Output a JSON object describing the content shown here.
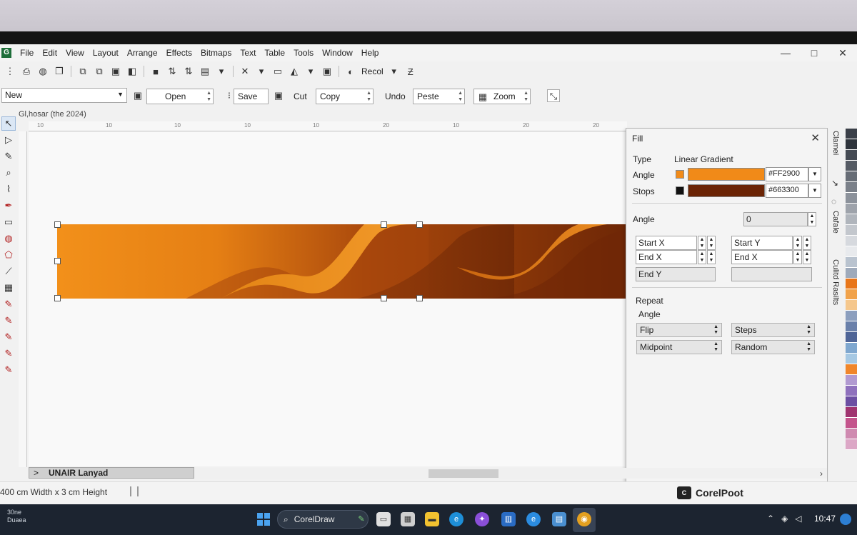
{
  "menu": [
    "File",
    "Edit",
    "View",
    "Layout",
    "Arrange",
    "Effects",
    "Bitmaps",
    "Text",
    "Table",
    "Tools",
    "Window",
    "Help"
  ],
  "window_controls": {
    "minimize": "—",
    "maximize": "□",
    "close": "✕"
  },
  "toolbar1": {
    "recol_label": "Recol"
  },
  "propbar": {
    "preset_value": "New",
    "open_label": "Open",
    "save_label": "Save",
    "cut_label": "Cut",
    "copy_label": "Copy",
    "undo_label": "Undo",
    "paste_label": "Peste",
    "zoom_label": "Zoom"
  },
  "document": {
    "title": "Gl,hosar (the 2024)"
  },
  "ruler_ticks": [
    "10",
    "10",
    "10",
    "10",
    "10",
    "20",
    "10",
    "20",
    "20",
    "20"
  ],
  "fill_panel": {
    "title": "Fill",
    "type_label": "Type",
    "type_value": "Linear Gradient",
    "angle_label": "Angle",
    "stops_label": "Stops",
    "color1_hex": "#FF2900",
    "color1_display": "#f18a18",
    "color2_hex": "#663300",
    "color2_display": "#6b2405",
    "angle2_label": "Angle",
    "angle_value": "0",
    "start_x": "Start X",
    "end_x": "End X",
    "start_y": "Start Y",
    "end_x_right": "End X",
    "end_y": "End Y",
    "repeat_label": "Repeat",
    "repeat_angle_label": "Angle",
    "flip_option": "Flip",
    "steps_option": "Steps",
    "midpoint_option": "Midpoint",
    "random_option": "Random"
  },
  "docker_tabs": [
    "Clamei",
    "Cafale",
    "Culitd Rasilts"
  ],
  "palette_colors": [
    "#3a3f48",
    "#2d333b",
    "#444a53",
    "#555b64",
    "#676d76",
    "#7a8089",
    "#8c929b",
    "#9ea3ab",
    "#b0b5bc",
    "#c3c7cd",
    "#d6d9de",
    "#e8eaed",
    "#b9c3cf",
    "#9eaabb",
    "#e8761a",
    "#f1a24a",
    "#f5c78c",
    "#8c9fbe",
    "#6a80aa",
    "#4f6597",
    "#7fa7cf",
    "#a6c8e3",
    "#f0862b",
    "#b19ad1",
    "#8f71bd",
    "#6c4fa3",
    "#a03470",
    "#c4548c",
    "#cf8ab0",
    "#dca7c6"
  ],
  "page_tab": {
    "arrow": ">",
    "label": "UNAIR Lanyad"
  },
  "status": {
    "dimensions_text": "400 cm Width x 3 cm Height"
  },
  "brand": {
    "icon": "C",
    "label": "CorelPoot"
  },
  "taskbar": {
    "left_line1": "30ne",
    "left_line2": "Duaea",
    "search_text": "CorelDraw",
    "time": "10:47"
  }
}
